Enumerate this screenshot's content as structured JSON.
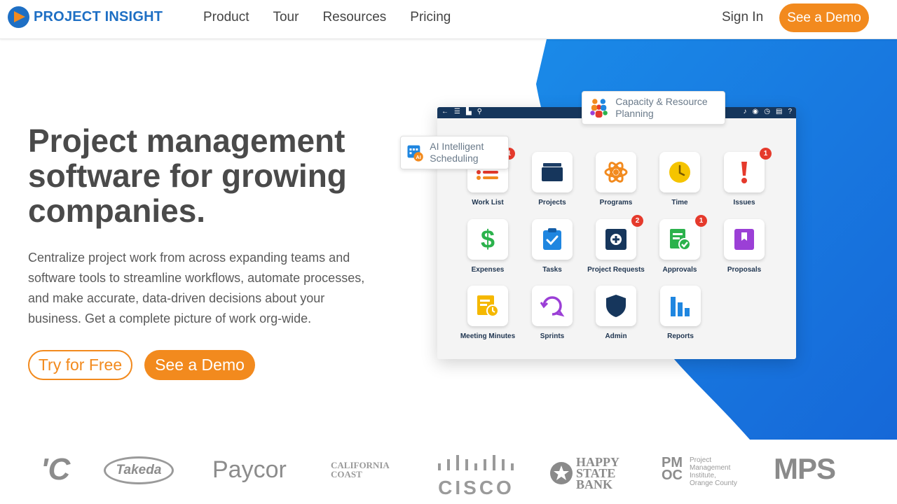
{
  "brand": {
    "name": "PROJECT INSIGHT"
  },
  "nav": {
    "items": [
      "Product",
      "Tour",
      "Resources",
      "Pricing"
    ],
    "sign_in": "Sign In",
    "demo": "See a Demo"
  },
  "hero": {
    "title": "Project management software for growing companies.",
    "description": "Centralize project work from across expanding teams and software tools to streamline workflows, automate processes, and make accurate, data-driven decisions about your business. Get a complete picture of work org-wide.",
    "try_button": "Try for Free",
    "demo_button": "See a Demo"
  },
  "app": {
    "callout_capacity": "Capacity & Resource Planning",
    "callout_ai": "AI Intelligent Scheduling",
    "tiles": [
      {
        "label": "Work List",
        "icon": "list-icon",
        "badge": "1"
      },
      {
        "label": "Projects",
        "icon": "folder-icon",
        "badge": ""
      },
      {
        "label": "Programs",
        "icon": "atom-icon",
        "badge": ""
      },
      {
        "label": "Time",
        "icon": "clock-icon",
        "badge": ""
      },
      {
        "label": "Issues",
        "icon": "exclamation-icon",
        "badge": "1"
      },
      {
        "label": "Expenses",
        "icon": "dollar-icon",
        "badge": ""
      },
      {
        "label": "Tasks",
        "icon": "clipboard-check-icon",
        "badge": ""
      },
      {
        "label": "Project Requests",
        "icon": "plus-box-icon",
        "badge": "2"
      },
      {
        "label": "Approvals",
        "icon": "approval-doc-icon",
        "badge": "1"
      },
      {
        "label": "Proposals",
        "icon": "bookmark-icon",
        "badge": ""
      },
      {
        "label": "Meeting Minutes",
        "icon": "minutes-doc-icon",
        "badge": ""
      },
      {
        "label": "Sprints",
        "icon": "sprint-cycle-icon",
        "badge": ""
      },
      {
        "label": "Admin",
        "icon": "shield-icon",
        "badge": ""
      },
      {
        "label": "Reports",
        "icon": "bar-chart-icon",
        "badge": ""
      }
    ]
  },
  "logos": {
    "items": [
      "'C",
      "Takeda",
      "Paycor",
      "CALIFORNIA COAST",
      "CISCO",
      "HAPPY STATE BANK",
      "Project Management Institute Orange County",
      "MPS"
    ],
    "pmi_lines": [
      "Project",
      "Management",
      "Institute,",
      "Orange County"
    ]
  },
  "colors": {
    "brand_blue": "#1e6fc4",
    "accent_orange": "#f28a1e",
    "hero_blue": "#1f7fe0"
  }
}
